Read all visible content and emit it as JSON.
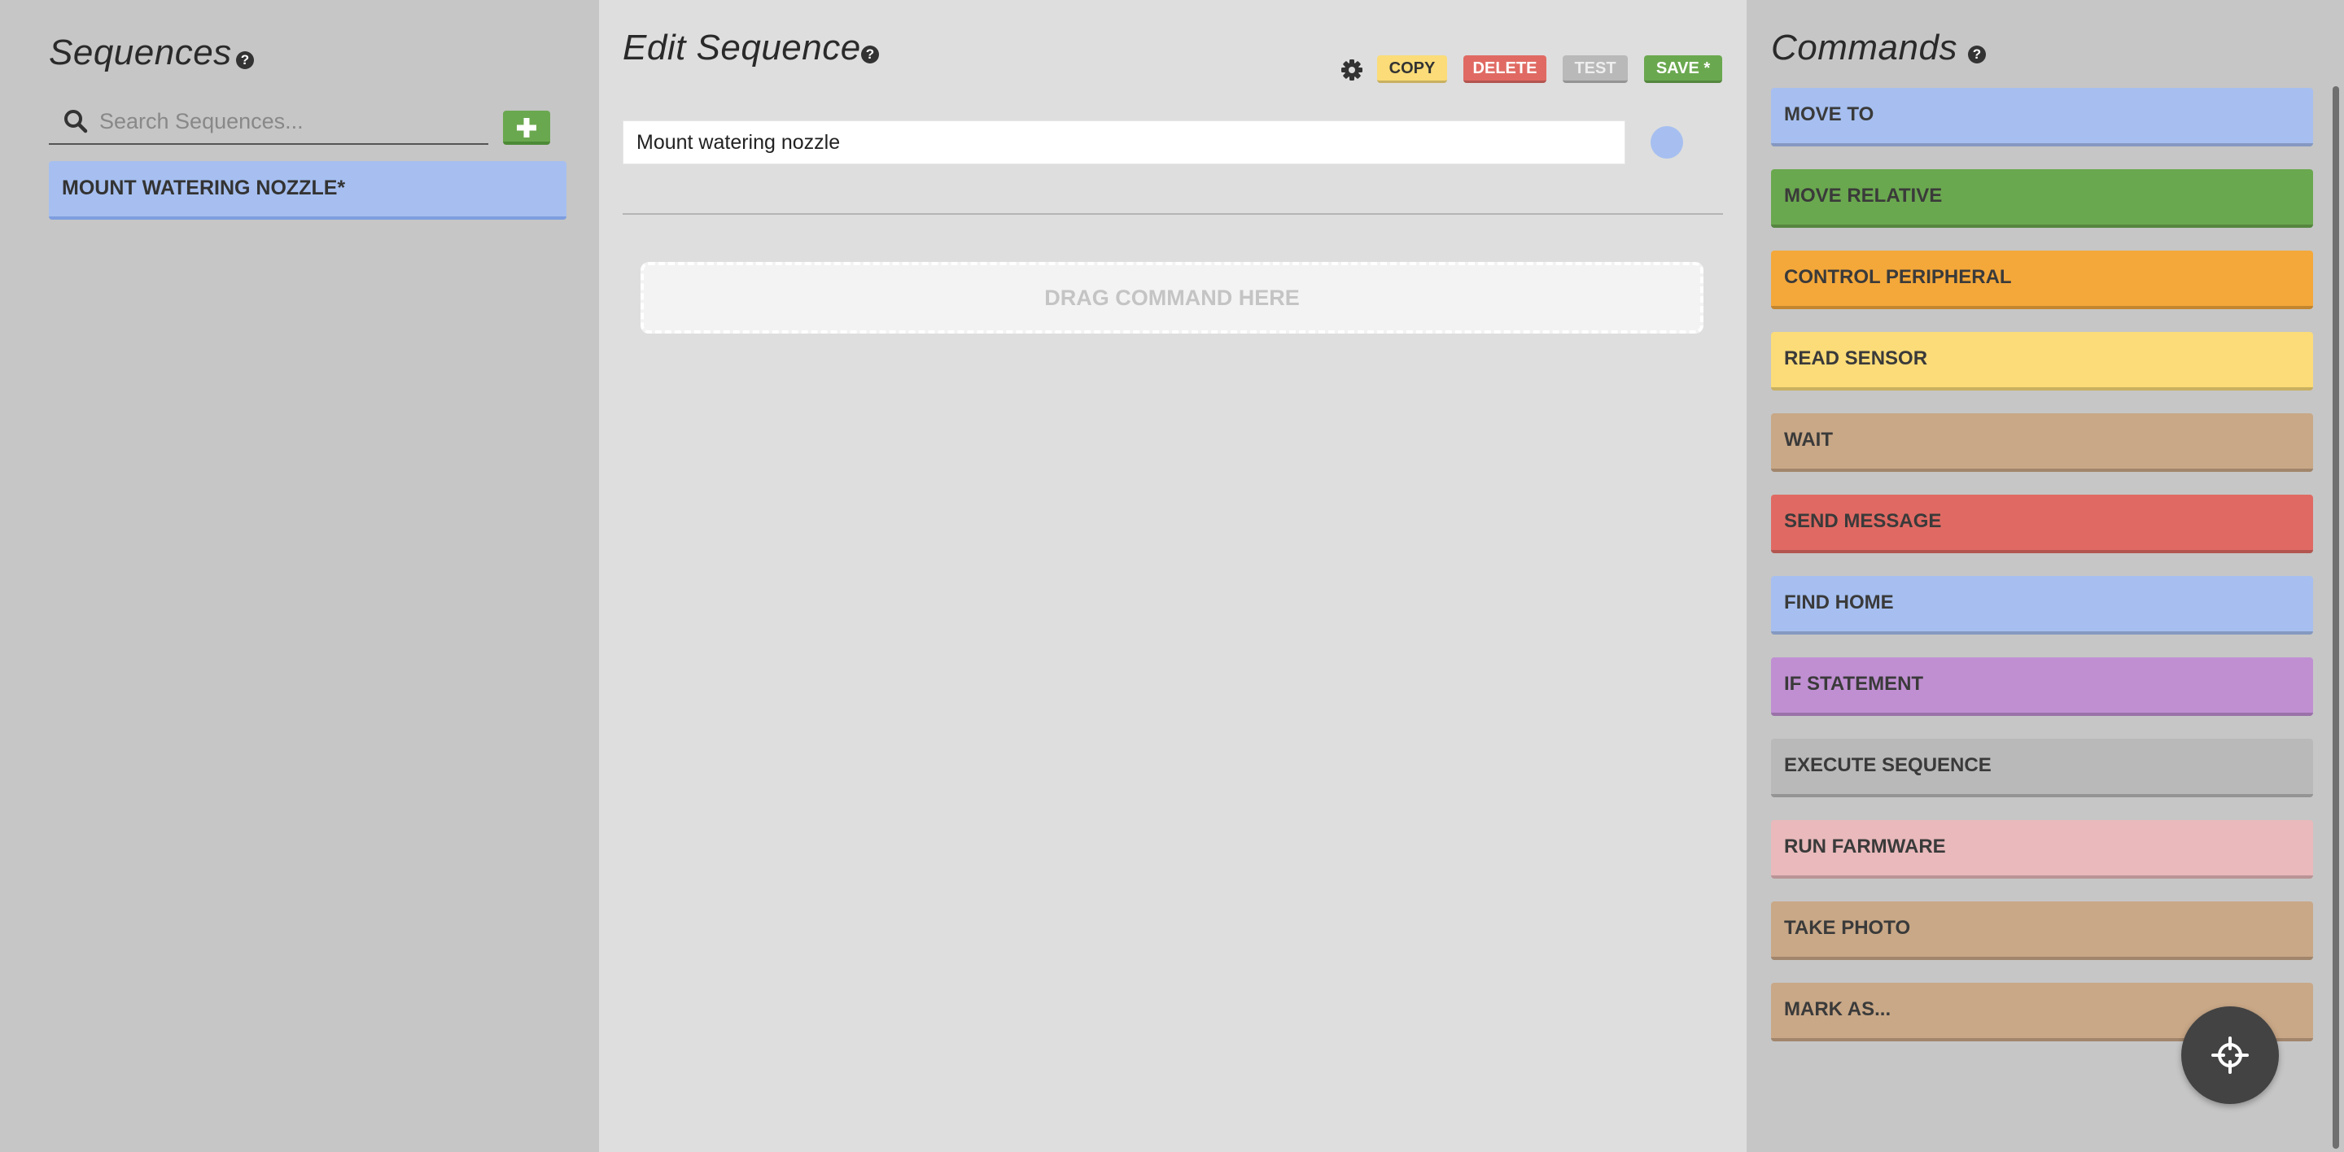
{
  "left": {
    "title": "Sequences",
    "search_placeholder": "Search Sequences...",
    "items": [
      {
        "label": "MOUNT WATERING NOZZLE*",
        "color": "#a6bff0"
      }
    ]
  },
  "editor": {
    "title": "Edit Sequence",
    "buttons": {
      "copy": "COPY",
      "delete": "DELETE",
      "test": "TEST",
      "save": "SAVE *"
    },
    "name_value": "Mount watering nozzle",
    "dropzone": "DRAG COMMAND HERE",
    "sequence_color": "#a6bff0"
  },
  "commands": {
    "title": "Commands",
    "items": [
      {
        "label": "MOVE TO",
        "color": "#a6bff0"
      },
      {
        "label": "MOVE RELATIVE",
        "color": "#6aa84f"
      },
      {
        "label": "CONTROL PERIPHERAL",
        "color": "#f4a83a"
      },
      {
        "label": "READ SENSOR",
        "color": "#fbdc78"
      },
      {
        "label": "WAIT",
        "color": "#c9a887"
      },
      {
        "label": "SEND MESSAGE",
        "color": "#e06a63"
      },
      {
        "label": "FIND HOME",
        "color": "#a6bff0"
      },
      {
        "label": "IF STATEMENT",
        "color": "#c08fd2"
      },
      {
        "label": "EXECUTE SEQUENCE",
        "color": "#b9b9b9"
      },
      {
        "label": "RUN FARMWARE",
        "color": "#e9b9bb"
      },
      {
        "label": "TAKE PHOTO",
        "color": "#c9a887"
      },
      {
        "label": "MARK AS...",
        "color": "#c9a887"
      }
    ]
  },
  "icons": {
    "help": "question-circle-icon",
    "search": "search-icon",
    "add": "plus-icon",
    "settings": "gear-icon",
    "fab": "crosshair-icon"
  },
  "help_glyph": "?",
  "add_glyph": "+"
}
